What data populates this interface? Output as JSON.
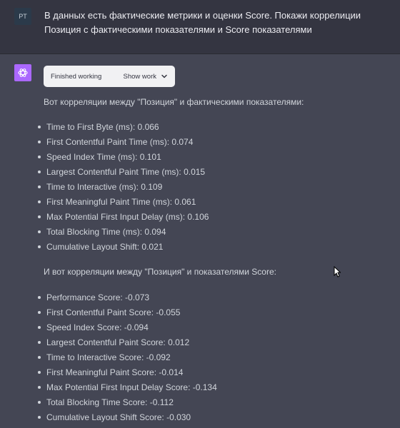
{
  "user": {
    "avatar_initials": "PT",
    "message": "В данных есть фактические метрики и оценки Score. Покажи коррелиции Позиция с фактическими показателями и Score показателями"
  },
  "assistant": {
    "avatar_icon": "openai-logo-icon",
    "avatar_color": "#ab68ff",
    "status_label": "Finished working",
    "show_work_label": "Show work",
    "intro_actual": "Вот корреляции между \"Позиция\" и фактическими показателями:",
    "actual_metrics": [
      "Time to First Byte (ms): 0.066",
      "First Contentful Paint Time (ms): 0.074",
      "Speed Index Time (ms): 0.101",
      "Largest Contentful Paint Time (ms): 0.015",
      "Time to Interactive (ms): 0.109",
      "First Meaningful Paint Time (ms): 0.061",
      "Max Potential First Input Delay (ms): 0.106",
      "Total Blocking Time (ms): 0.094",
      "Cumulative Layout Shift: 0.021"
    ],
    "intro_score": "И вот корреляции между \"Позиция\" и показателями Score:",
    "score_metrics": [
      "Performance Score: -0.073",
      "First Contentful Paint Score: -0.055",
      "Speed Index Score: -0.094",
      "Largest Contentful Paint Score: 0.012",
      "Time to Interactive Score: -0.092",
      "First Meaningful Paint Score: -0.014",
      "Max Potential First Input Delay Score: -0.134",
      "Total Blocking Time Score: -0.112",
      "Cumulative Layout Shift Score: -0.030"
    ]
  },
  "colors": {
    "page_background": "#444654",
    "user_row_background": "#343541",
    "text": "#d1d5db"
  }
}
